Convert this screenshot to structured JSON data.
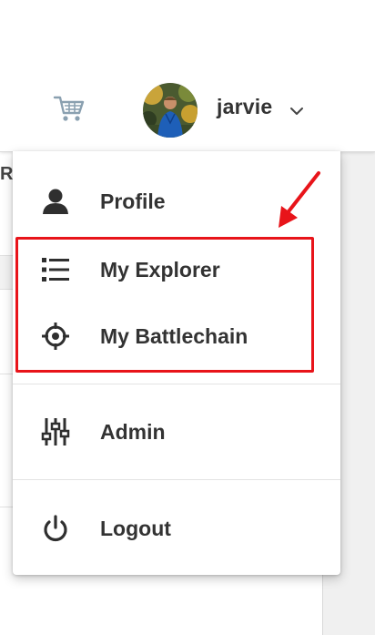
{
  "header": {
    "cart_icon": "shopping-cart-icon",
    "user": {
      "name": "jarvie",
      "chevron_icon": "chevron-down-icon"
    }
  },
  "background": {
    "fragment_text": "RI"
  },
  "user_menu": {
    "items": [
      {
        "label": "Profile",
        "icon": "person-icon"
      },
      {
        "label": "My Explorer",
        "icon": "list-icon"
      },
      {
        "label": "My Battlechain",
        "icon": "crosshair-icon"
      },
      {
        "label": "Admin",
        "icon": "sliders-icon"
      },
      {
        "label": "Logout",
        "icon": "power-icon"
      }
    ]
  },
  "annotation": {
    "color": "#e8141a"
  }
}
